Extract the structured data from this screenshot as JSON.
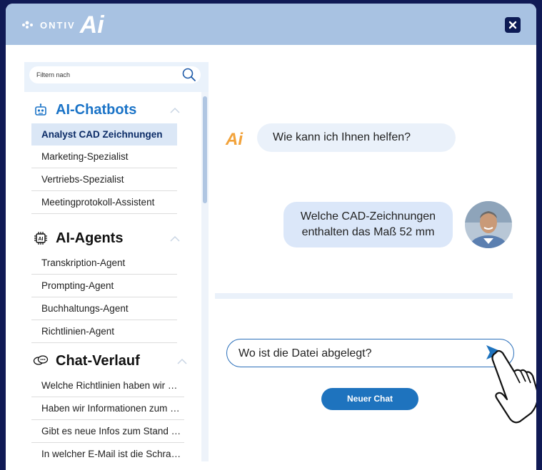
{
  "header": {
    "logo_text": "ONTIV",
    "logo_mark": "Ai",
    "close_icon": "close-icon"
  },
  "sidebar": {
    "filter": {
      "placeholder": "Filtern nach",
      "value": ""
    },
    "sections": [
      {
        "title": "AI-Chatbots",
        "icon": "robot-icon",
        "items": [
          {
            "label": "Analyst CAD Zeichnungen",
            "active": true
          },
          {
            "label": "Marketing-Spezialist"
          },
          {
            "label": "Vertriebs-Spezialist"
          },
          {
            "label": "Meetingprotokoll-Assistent"
          }
        ]
      },
      {
        "title": "AI-Agents",
        "icon": "ai-chip-icon",
        "items": [
          {
            "label": "Transkription-Agent"
          },
          {
            "label": "Prompting-Agent"
          },
          {
            "label": "Buchhaltungs-Agent"
          },
          {
            "label": "Richtlinien-Agent"
          }
        ]
      },
      {
        "title": "Chat-Verlauf",
        "icon": "chat-bubbles-icon",
        "items": [
          {
            "label": "Welche Richtlinien haben wir …"
          },
          {
            "label": "Haben wir Informationen zum …"
          },
          {
            "label": "Gibt es neue Infos zum Stand …"
          },
          {
            "label": "In welcher E-Mail ist die Schra…"
          }
        ]
      }
    ]
  },
  "chat": {
    "bot_message": "Wie kann ich Ihnen helfen?",
    "user_message_line1": "Welche CAD-Zeichnungen",
    "user_message_line2": "enthalten das Maß 52 mm",
    "input_value": "Wo ist die Datei abgelegt?",
    "new_chat_label": "Neuer Chat"
  },
  "colors": {
    "background": "#101a55",
    "header": "#a8c2e2",
    "accent": "#1e73be"
  }
}
